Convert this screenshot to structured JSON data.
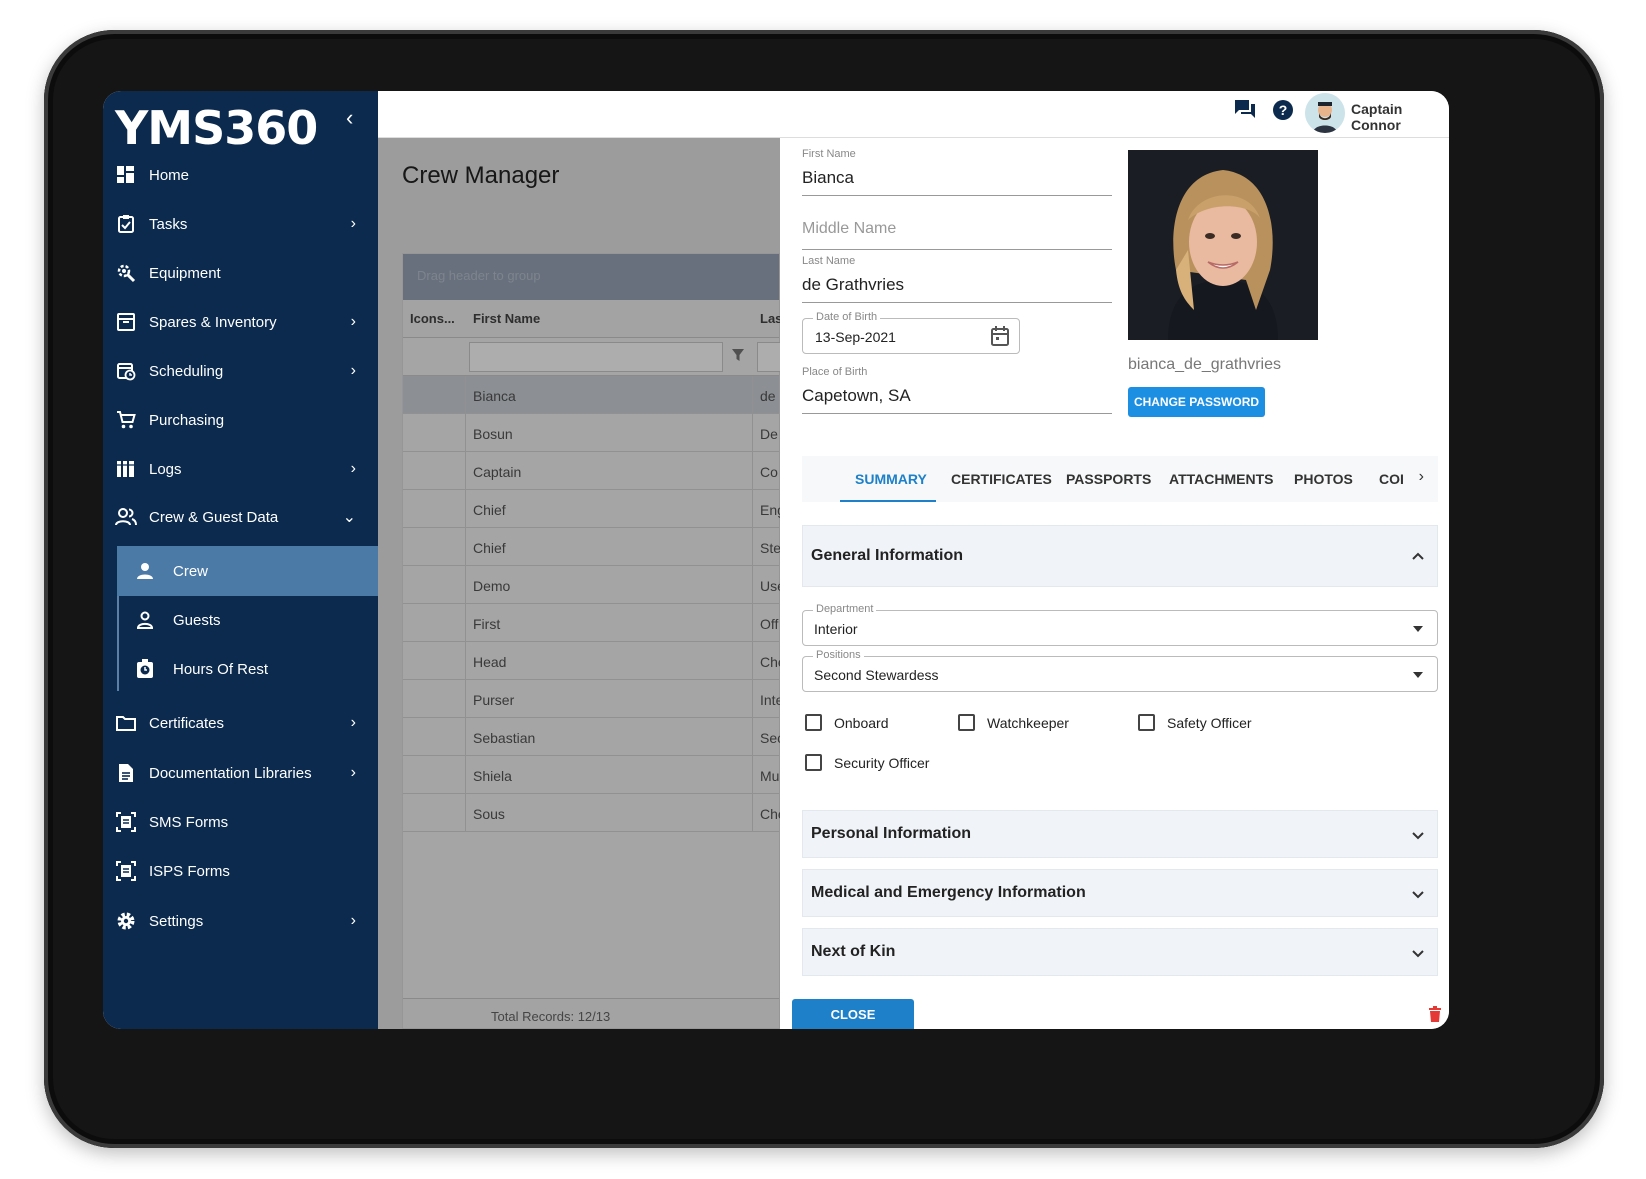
{
  "app": {
    "logo": "YMS360",
    "collapse_icon": "chevron-left-icon"
  },
  "topbar": {
    "user_name": "Captain Connor",
    "icons": [
      "chat-icon",
      "help-icon",
      "avatar"
    ]
  },
  "sidebar": {
    "items": [
      {
        "label": "Home",
        "icon": "dashboard-icon",
        "has_chevron": false
      },
      {
        "label": "Tasks",
        "icon": "clipboard-check-icon",
        "has_chevron": true
      },
      {
        "label": "Equipment",
        "icon": "wrench-gear-icon",
        "has_chevron": false
      },
      {
        "label": "Spares & Inventory",
        "icon": "inventory-icon",
        "has_chevron": true
      },
      {
        "label": "Scheduling",
        "icon": "calendar-clock-icon",
        "has_chevron": true
      },
      {
        "label": "Purchasing",
        "icon": "cart-icon",
        "has_chevron": false
      },
      {
        "label": "Logs",
        "icon": "books-icon",
        "has_chevron": true
      },
      {
        "label": "Crew & Guest Data",
        "icon": "people-icon",
        "has_chevron": true,
        "expanded": true
      },
      {
        "label": "Certificates",
        "icon": "folder-icon",
        "has_chevron": true
      },
      {
        "label": "Documentation Libraries",
        "icon": "document-icon",
        "has_chevron": true
      },
      {
        "label": "SMS Forms",
        "icon": "form-icon",
        "has_chevron": false
      },
      {
        "label": "ISPS Forms",
        "icon": "form-icon",
        "has_chevron": false
      },
      {
        "label": "Settings",
        "icon": "gear-icon",
        "has_chevron": true
      }
    ],
    "sub_items": [
      {
        "label": "Crew",
        "icon": "person-icon",
        "active": true
      },
      {
        "label": "Guests",
        "icon": "person-outline-icon",
        "active": false
      },
      {
        "label": "Hours Of Rest",
        "icon": "stopwatch-icon",
        "active": false
      }
    ]
  },
  "main": {
    "title": "Crew Manager",
    "group_hint": "Drag header to group",
    "columns": [
      "Icons...",
      "First Name",
      "Las"
    ],
    "rows": [
      {
        "first": "Bianca",
        "last": "de",
        "selected": true
      },
      {
        "first": "Bosun",
        "last": "De"
      },
      {
        "first": "Captain",
        "last": "Co"
      },
      {
        "first": "Chief",
        "last": "Eng"
      },
      {
        "first": "Chief",
        "last": "Ste"
      },
      {
        "first": "Demo",
        "last": "Use"
      },
      {
        "first": "First",
        "last": "Off"
      },
      {
        "first": "Head",
        "last": "Che"
      },
      {
        "first": "Purser",
        "last": "Inte"
      },
      {
        "first": "Sebastian",
        "last": "Sec"
      },
      {
        "first": "Shiela",
        "last": "Mu"
      },
      {
        "first": "Sous",
        "last": "Che"
      }
    ],
    "total_records": "Total Records: 12/13"
  },
  "panel": {
    "first_name_label": "First Name",
    "first_name": "Bianca",
    "middle_name_placeholder": "Middle Name",
    "last_name_label": "Last Name",
    "last_name": "de Grathvries",
    "dob_label": "Date of Birth",
    "dob": "13-Sep-2021",
    "pob_label": "Place of Birth",
    "pob": "Capetown, SA",
    "username": "bianca_de_grathvries",
    "change_password": "CHANGE PASSWORD",
    "tabs": [
      "SUMMARY",
      "CERTIFICATES",
      "PASSPORTS",
      "ATTACHMENTS",
      "PHOTOS",
      "COI"
    ],
    "active_tab": "SUMMARY",
    "general_info": "General Information",
    "department_label": "Department",
    "department": "Interior",
    "positions_label": "Positions",
    "positions": "Second Stewardess",
    "checkboxes": [
      {
        "label": "Onboard",
        "checked": false
      },
      {
        "label": "Watchkeeper",
        "checked": false
      },
      {
        "label": "Safety Officer",
        "checked": false
      },
      {
        "label": "Security Officer",
        "checked": false
      }
    ],
    "sections": [
      "Personal Information",
      "Medical and Emergency Information",
      "Next of Kin"
    ],
    "close": "CLOSE"
  },
  "colors": {
    "sidebar_bg": "#0b2a4e",
    "active_nav": "#4b7aa6",
    "accent": "#1d80c9",
    "danger": "#e53935"
  }
}
